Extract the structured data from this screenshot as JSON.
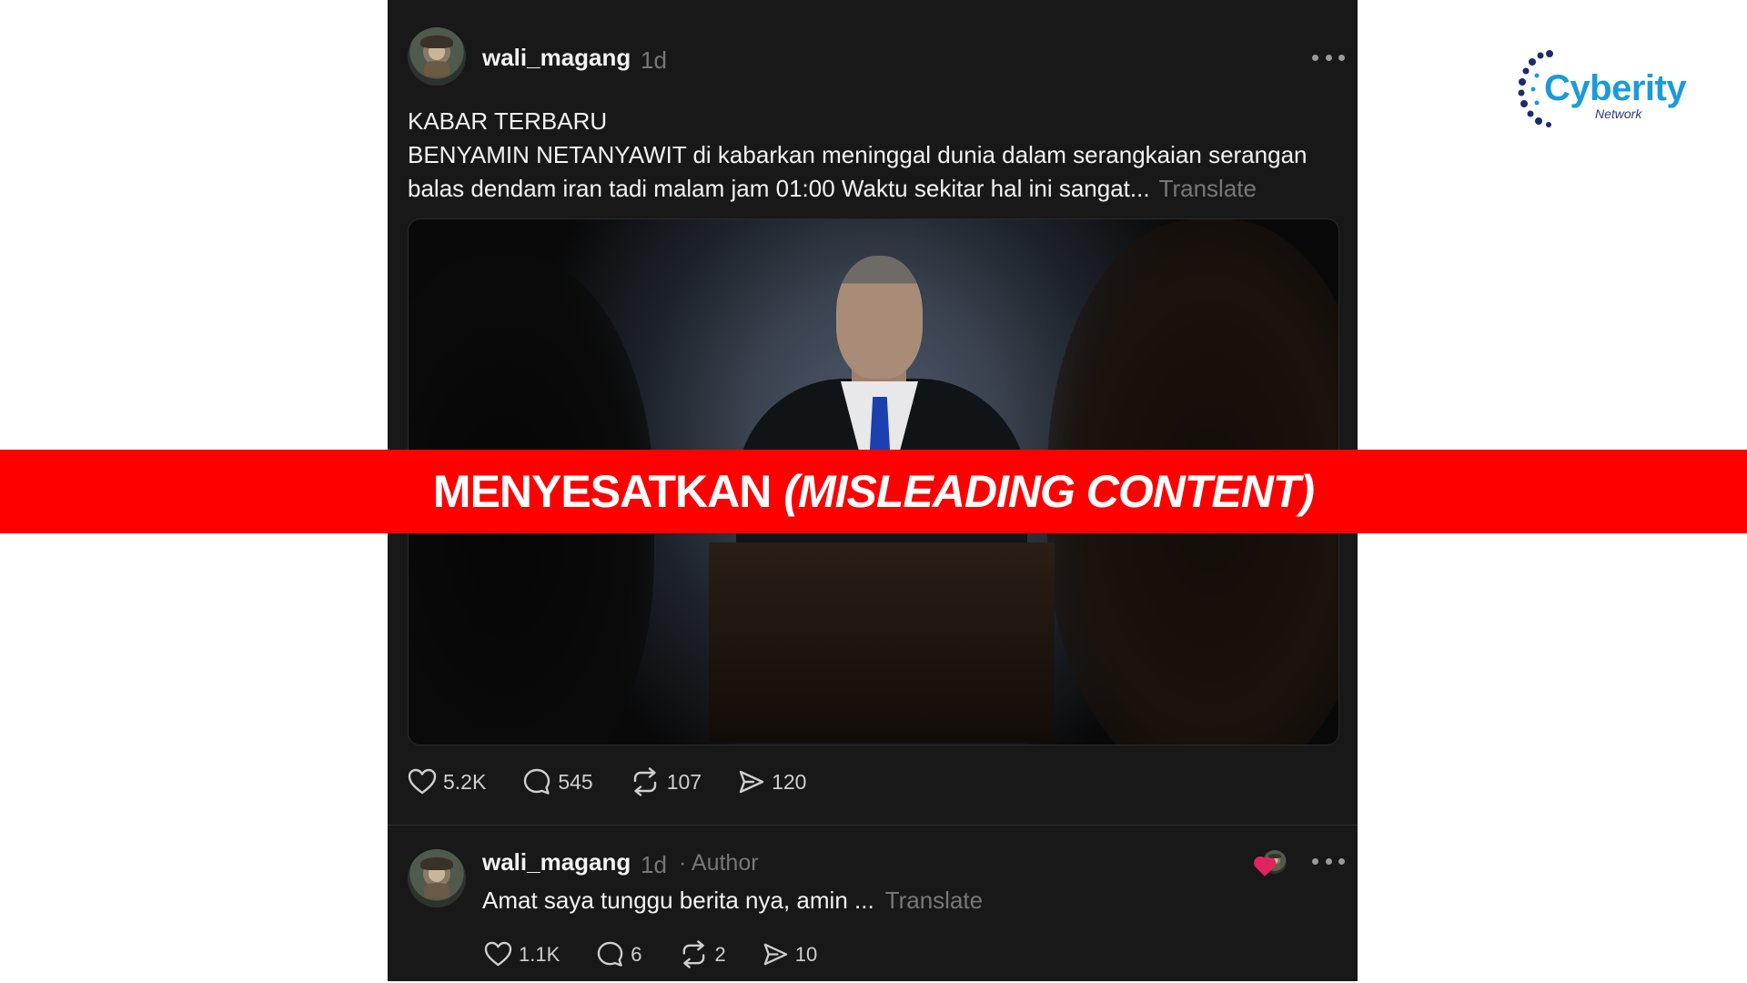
{
  "post": {
    "username": "wali_magang",
    "time": "1d",
    "text_line1": "KABAR TERBARU",
    "text_line2": "BENYAMIN NETANYAWIT di kabarkan meninggal dunia dalam serangkaian serangan",
    "text_line3": "balas dendam iran tadi malam jam 01:00 Waktu sekitar hal ini sangat...",
    "translate_label": "Translate",
    "stats": {
      "likes": "5.2K",
      "comments": "545",
      "reposts": "107",
      "shares": "120"
    }
  },
  "reply": {
    "username": "wali_magang",
    "time": "1d",
    "author_tag": "· Author",
    "text": "Amat saya tunggu berita nya, amin ...",
    "translate_label": "Translate",
    "stats": {
      "likes": "1.1K",
      "comments": "6",
      "reposts": "2",
      "shares": "10"
    }
  },
  "banner": {
    "main": "MENYESATKAN",
    "paren": "(MISLEADING CONTENT)",
    "color": "#ff0000"
  },
  "logo": {
    "name": "Cyberity",
    "sub": "Network",
    "color": "#1b9bd7"
  },
  "icons": [
    "heart-icon",
    "comment-icon",
    "repost-icon",
    "share-icon",
    "more-icon"
  ]
}
